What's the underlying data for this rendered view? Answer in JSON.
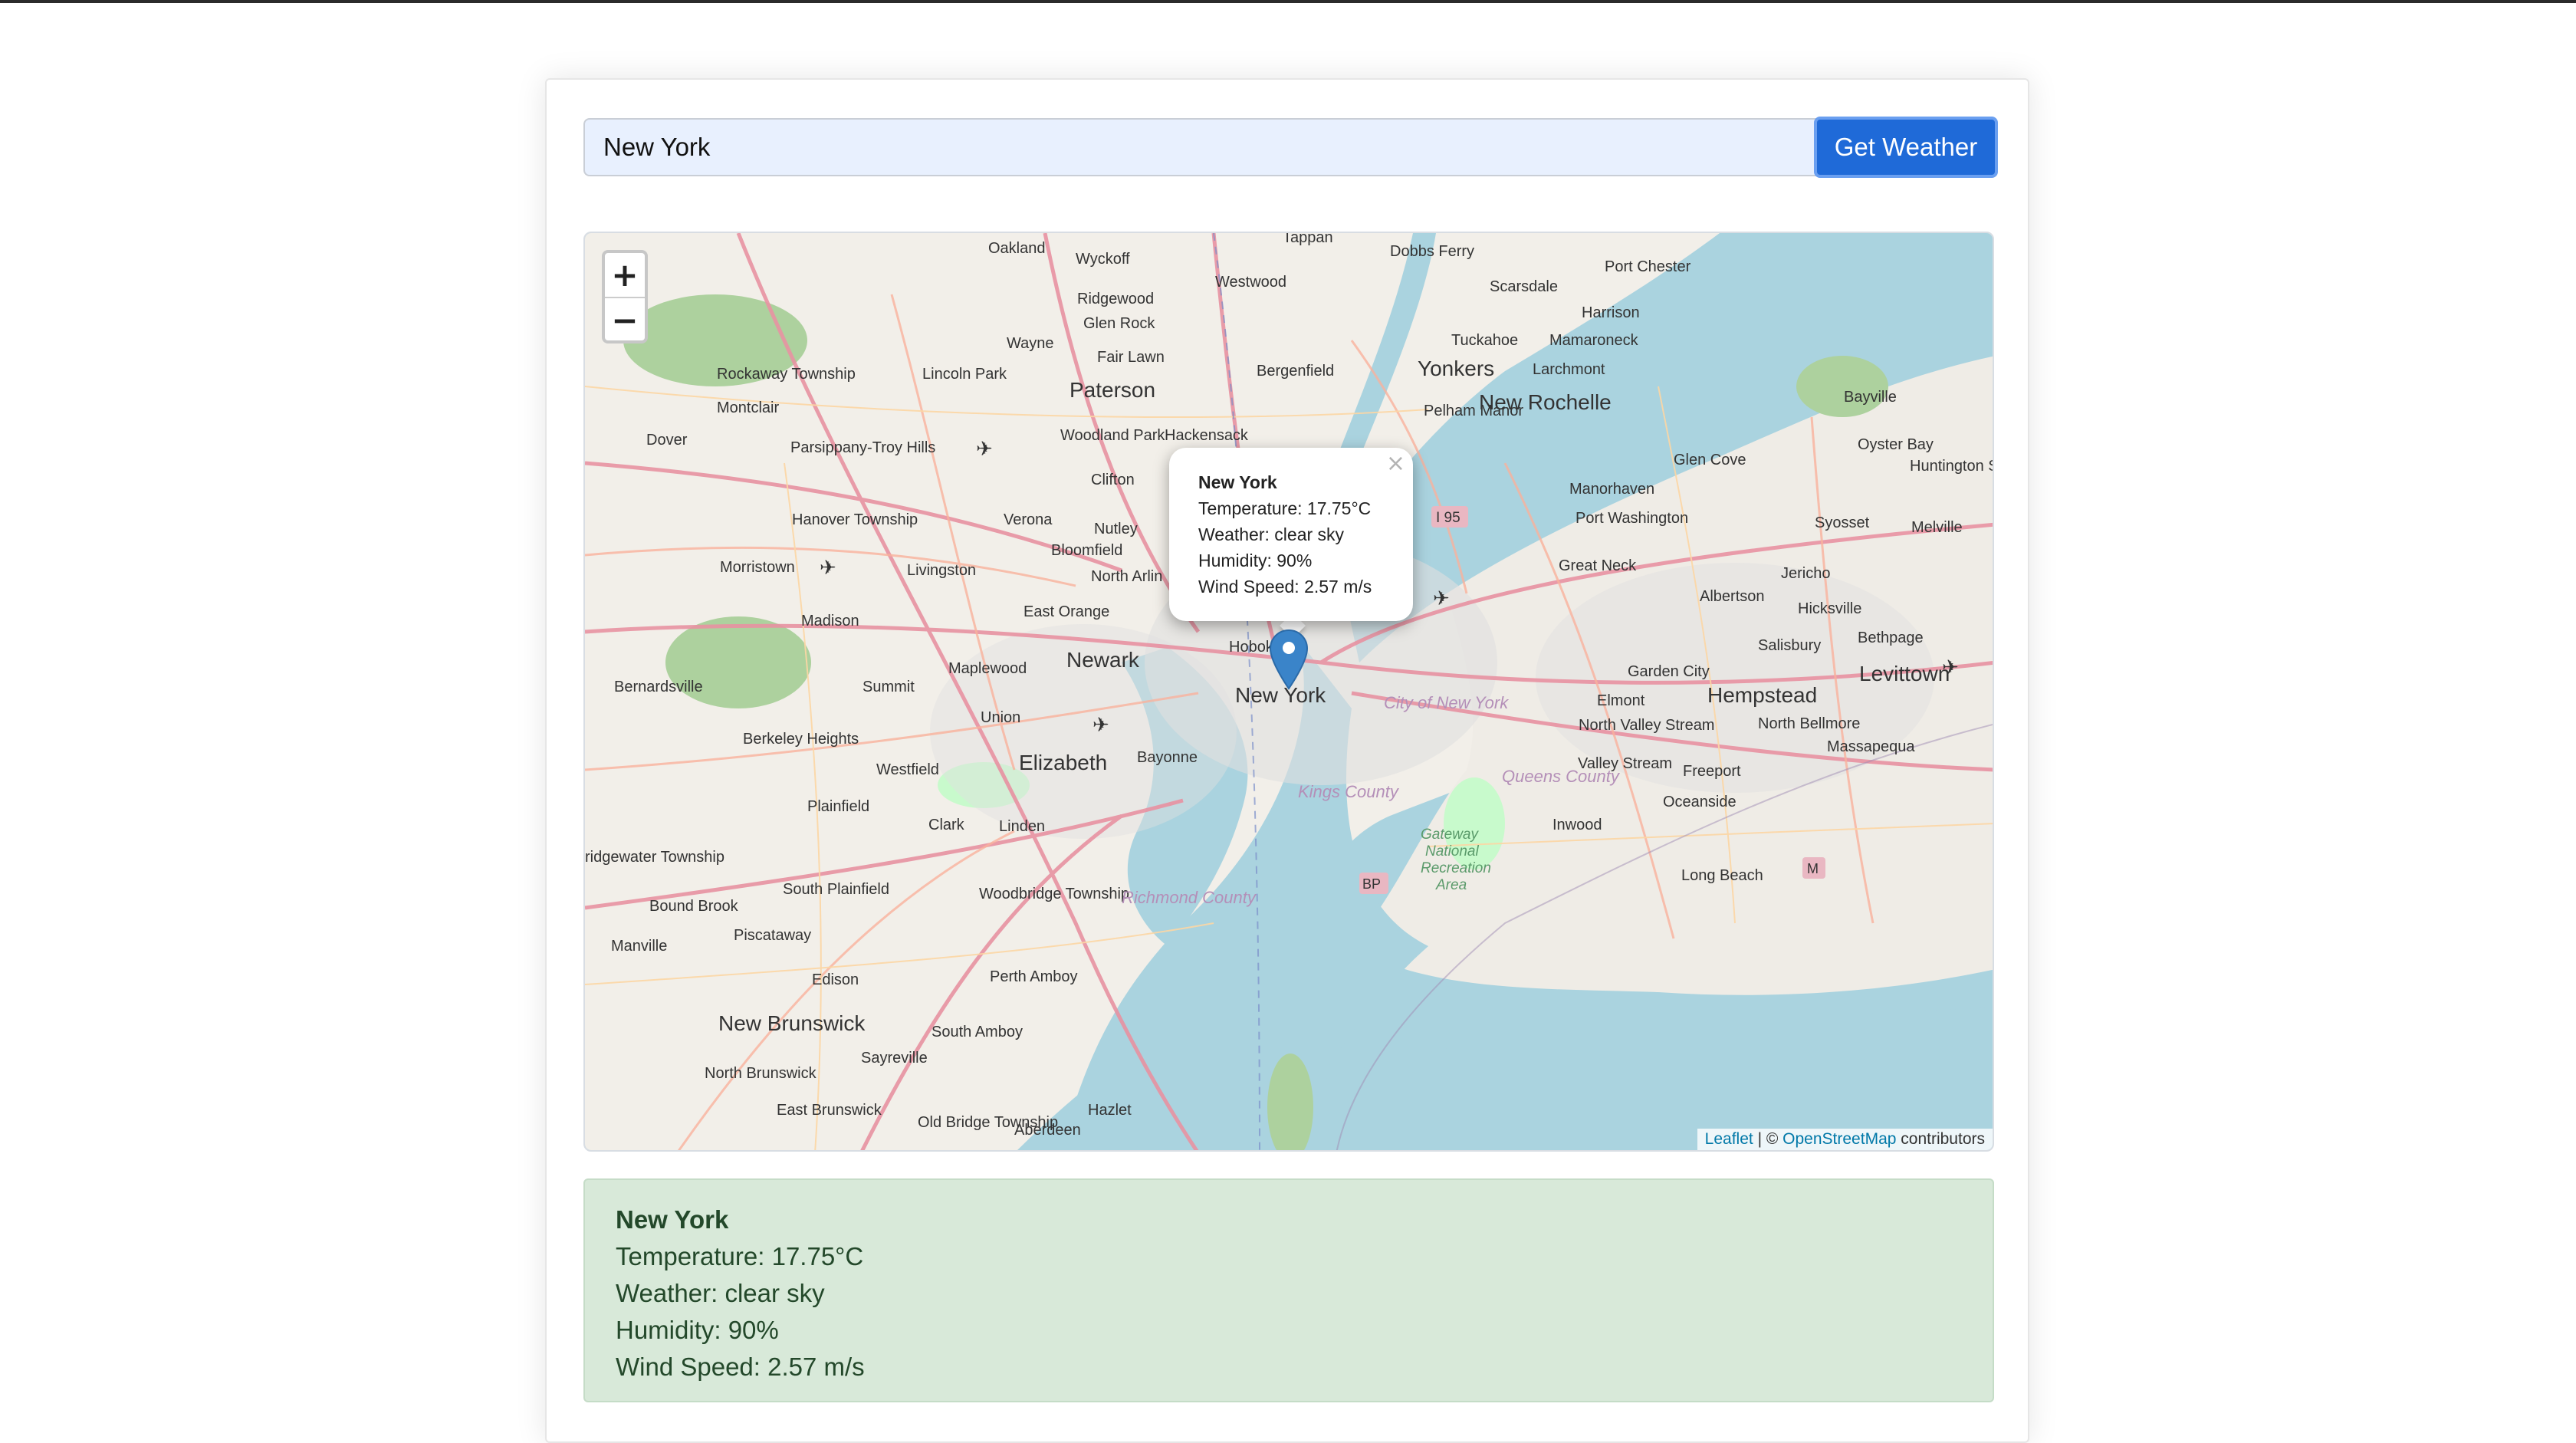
{
  "search": {
    "value": "New York",
    "button_label": "Get Weather"
  },
  "map": {
    "zoom_in_label": "+",
    "zoom_out_label": "−",
    "popup": {
      "close_label": "×",
      "city": "New York",
      "temperature": "Temperature: 17.75°C",
      "weather": "Weather: clear sky",
      "humidity": "Humidity: 90%",
      "wind": "Wind Speed: 2.57 m/s"
    },
    "attribution": {
      "leaflet": "Leaflet",
      "sep": " | © ",
      "osm": "OpenStreetMap",
      "suffix": " contributors"
    },
    "place_labels": {
      "newyork": "New York",
      "newark": "Newark",
      "paterson": "Paterson",
      "yonkers": "Yonkers",
      "newrochelle": "New Rochelle",
      "elizabeth": "Elizabeth",
      "hempstead": "Hempstead",
      "levittown": "Levittown",
      "newbrunswick": "New Brunswick",
      "bayonne": "Bayonne",
      "cityofny": "City of New York",
      "kings": "Kings County",
      "queens": "Queens County",
      "gateway": "Gateway National Recreation Area",
      "morristown": "Morristown",
      "summit": "Summit",
      "clifton": "Clifton",
      "hackensack": "Hackensack",
      "glencove": "Glen Cove",
      "longbeach": "Long Beach",
      "freeport": "Freeport",
      "edison": "Edison",
      "plainfield": "Plainfield",
      "perthamboy": "Perth Amboy",
      "wayne": "Wayne",
      "eastorange": "East Orange",
      "ridgewood": "Ridgewood",
      "scarsdale": "Scarsdale",
      "portwashington": "Port Washington",
      "hicksville": "Hicksville",
      "oceanside": "Oceanside",
      "elmont": "Elmont",
      "greatneck": "Great Neck",
      "sayreville": "Sayreville",
      "westfield": "Westfield",
      "union": "Union",
      "montclair": "Montclair",
      "hoboken": "Hobok",
      "livingston": "Livingston",
      "madison": "Madison",
      "oakland": "Oakland",
      "tappan": "Tappan",
      "dobbsferry": "Dobbs Ferry",
      "portchester": "Port Chester",
      "harrison": "Harrison",
      "bayville": "Bayville",
      "huntington": "Huntington Station",
      "syosset": "Syosset",
      "melville": "Melville",
      "jericho": "Jericho",
      "bethpage": "Bethpage",
      "massapequa": "Massapequa",
      "valleystream": "Valley Stream",
      "inwood": "Inwood",
      "rockaway": "Rockaway Township",
      "dover": "Dover",
      "parsippany": "Parsippany-Troy Hills",
      "hanover": "Hanover Township",
      "bernardsville": "Bernardsville",
      "berkeley": "Berkeley Heights",
      "clark": "Clark",
      "linden": "Linden",
      "woodbridge": "Woodbridge Township",
      "southplainfield": "South Plainfield",
      "boundbrook": "Bound Brook",
      "piscataway": "Piscataway",
      "manville": "Manville",
      "southamboy": "South Amboy",
      "northbrunswick": "North Brunswick",
      "eastbrunswick": "East Brunswick",
      "oldbridge": "Old Bridge Township",
      "aberdeen": "Aberdeen",
      "hazlet": "Hazlet",
      "richmond": "Richmond County",
      "verona": "Verona",
      "nutley": "Nutley",
      "bloomfield": "Bloomfield",
      "northarlington": "North Arlin",
      "maplewood": "Maplewood",
      "woodlandpark": "Woodland Park",
      "lincolnpark": "Lincoln Park",
      "fairlawn": "Fair Lawn",
      "glenrock": "Glen Rock",
      "bergenfield": "Bergenfield",
      "westwood": "Westwood",
      "wyckoff": "Wyckoff",
      "tuckahoe": "Tuckahoe",
      "mamaroneck": "Mamaroneck",
      "larchmont": "Larchmont",
      "pelham": "Pelham Manor",
      "manorhaven": "Manorhaven",
      "oysterbay": "Oyster Bay",
      "albertson": "Albertson",
      "salisbury": "Salisbury",
      "gardencity": "Garden City",
      "northvalley": "North Valley Stream",
      "northbellmore": "North Bellmore",
      "i95": "I 95",
      "bp": "BP",
      "m": "M"
    }
  },
  "result": {
    "city": "New York",
    "temperature": "Temperature: 17.75°C",
    "weather": "Weather: clear sky",
    "humidity": "Humidity: 90%",
    "wind": "Wind Speed: 2.57 m/s"
  }
}
